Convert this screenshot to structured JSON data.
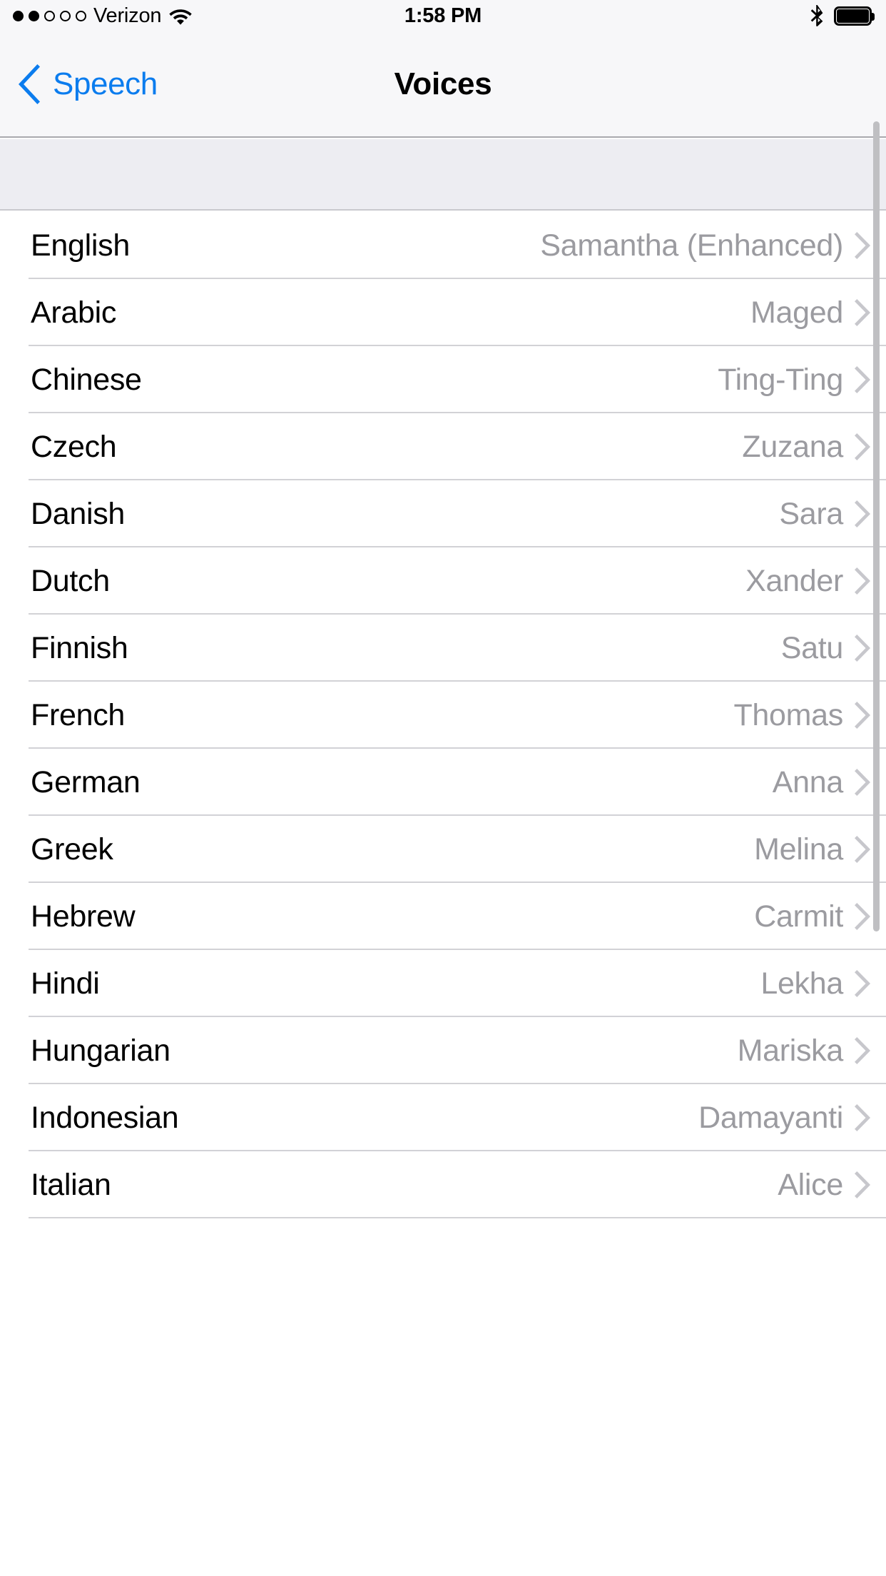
{
  "status_bar": {
    "carrier": "Verizon",
    "signal_dots_total": 5,
    "signal_dots_filled": 2,
    "wifi_icon": "wifi-icon",
    "time": "1:58 PM",
    "bluetooth_icon": "bluetooth-icon",
    "battery_icon": "battery-icon",
    "battery_level_percent": 100
  },
  "nav_bar": {
    "back_label": "Speech",
    "back_icon": "chevron-left-icon",
    "title": "Voices"
  },
  "colors": {
    "accent_blue": "#0B7CEE",
    "bar_background": "#F7F7F9",
    "section_header_background": "#EDEDF2",
    "value_text": "#9B9BA0",
    "separator": "#D2D2D6",
    "chevron": "#C7C7CC",
    "scrollbar": "#BFBFC2"
  },
  "list": {
    "disclosure_icon": "chevron-right-icon",
    "rows": [
      {
        "language": "English",
        "voice": "Samantha (Enhanced)"
      },
      {
        "language": "Arabic",
        "voice": "Maged"
      },
      {
        "language": "Chinese",
        "voice": "Ting-Ting"
      },
      {
        "language": "Czech",
        "voice": "Zuzana"
      },
      {
        "language": "Danish",
        "voice": "Sara"
      },
      {
        "language": "Dutch",
        "voice": "Xander"
      },
      {
        "language": "Finnish",
        "voice": "Satu"
      },
      {
        "language": "French",
        "voice": "Thomas"
      },
      {
        "language": "German",
        "voice": "Anna"
      },
      {
        "language": "Greek",
        "voice": "Melina"
      },
      {
        "language": "Hebrew",
        "voice": "Carmit"
      },
      {
        "language": "Hindi",
        "voice": "Lekha"
      },
      {
        "language": "Hungarian",
        "voice": "Mariska"
      },
      {
        "language": "Indonesian",
        "voice": "Damayanti"
      },
      {
        "language": "Italian",
        "voice": "Alice"
      }
    ]
  },
  "scrollbar": {
    "visible": true
  }
}
